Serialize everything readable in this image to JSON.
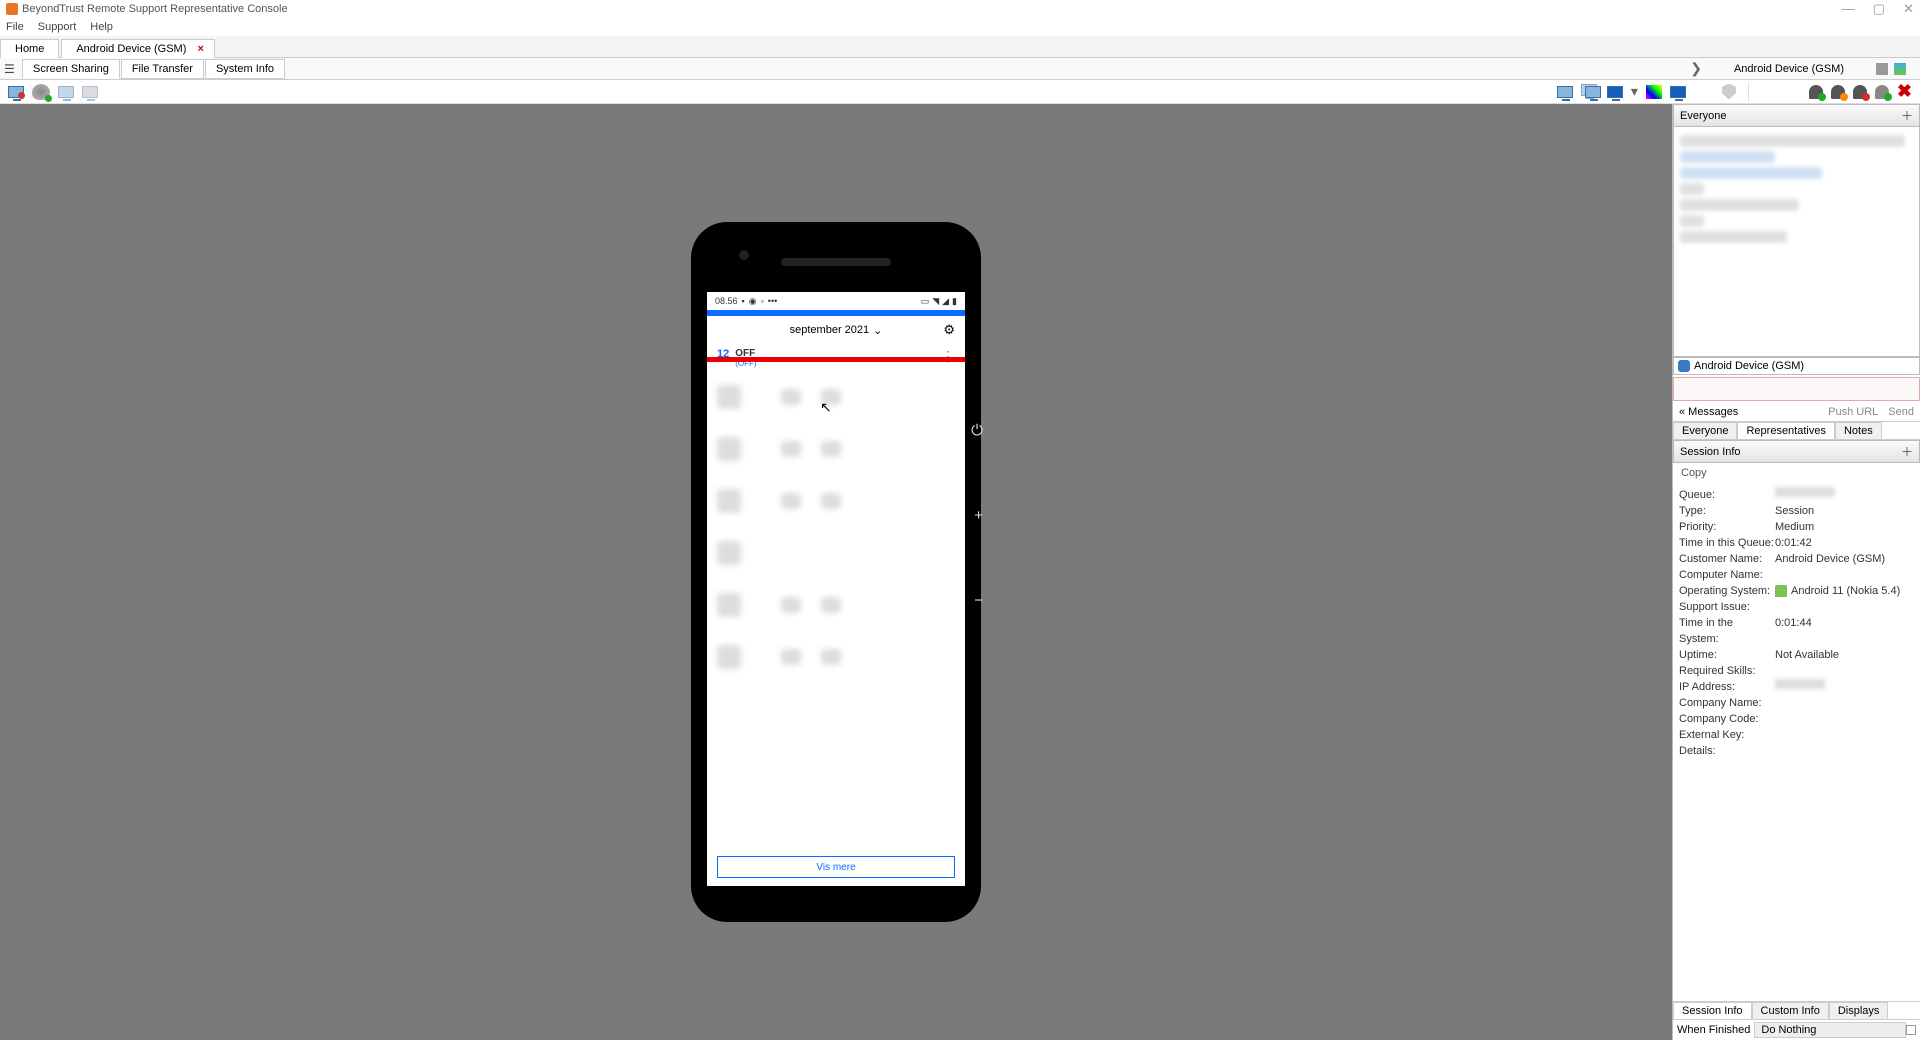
{
  "window": {
    "title": "BeyondTrust Remote Support Representative Console"
  },
  "menubar": {
    "file": "File",
    "support": "Support",
    "help": "Help"
  },
  "maintabs": {
    "home": "Home",
    "device": "Android Device (GSM)"
  },
  "subtabs": {
    "screenSharing": "Screen Sharing",
    "fileTransfer": "File Transfer",
    "systemInfo": "System Info"
  },
  "deviceLabel": "Android Device (GSM)",
  "phone": {
    "time": "08.56",
    "month": "september 2021",
    "dayNum": "12",
    "off": "OFF",
    "offSub": "(OFF)",
    "visMere": "Vis mere"
  },
  "rightpane": {
    "everyone": "Everyone",
    "deviceName": "Android Device (GSM)",
    "messagesBack": "« Messages",
    "pushUrl": "Push URL",
    "send": "Send",
    "miniTabs": {
      "everyone": "Everyone",
      "reps": "Representatives",
      "notes": "Notes"
    },
    "sessionInfoHeader": "Session Info",
    "copy": "Copy",
    "info": {
      "queueLabel": "Queue:",
      "typeLabel": "Type:",
      "typeVal": "Session",
      "priorityLabel": "Priority:",
      "priorityVal": "Medium",
      "timeQueueLabel": "Time in this Queue:",
      "timeQueueVal": "0:01:42",
      "customerNameLabel": "Customer Name:",
      "customerNameVal": "Android Device (GSM)",
      "computerNameLabel": "Computer Name:",
      "osLabel": "Operating System:",
      "osVal": "Android 11 (Nokia 5.4)",
      "supportIssueLabel": "Support Issue:",
      "timeSystemLabel": "Time in the System:",
      "timeSystemVal": "0:01:44",
      "uptimeLabel": "Uptime:",
      "uptimeVal": "Not Available",
      "requiredSkillsLabel": "Required Skills:",
      "ipLabel": "IP Address:",
      "companyNameLabel": "Company Name:",
      "companyCodeLabel": "Company Code:",
      "externalKeyLabel": "External Key:",
      "detailsLabel": "Details:"
    },
    "bottomTabs": {
      "sessionInfo": "Session Info",
      "customInfo": "Custom Info",
      "displays": "Displays"
    },
    "footer": {
      "whenFinished": "When Finished",
      "doNothing": "Do Nothing"
    }
  }
}
